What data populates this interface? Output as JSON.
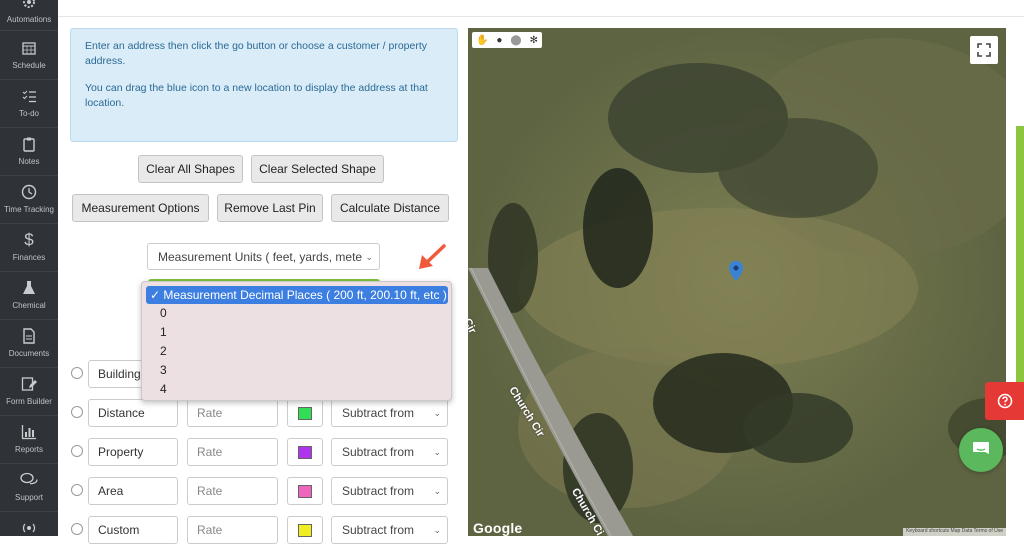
{
  "sidebar": {
    "items": [
      {
        "label": "Automations",
        "icon": "gear-icon"
      },
      {
        "label": "Schedule",
        "icon": "calendar-icon"
      },
      {
        "label": "To-do",
        "icon": "checklist-icon"
      },
      {
        "label": "Notes",
        "icon": "clipboard-icon"
      },
      {
        "label": "Time Tracking",
        "icon": "clock-icon"
      },
      {
        "label": "Finances",
        "icon": "dollar-icon"
      },
      {
        "label": "Chemical",
        "icon": "flask-icon"
      },
      {
        "label": "Documents",
        "icon": "document-icon"
      },
      {
        "label": "Form Builder",
        "icon": "form-edit-icon"
      },
      {
        "label": "Reports",
        "icon": "bar-chart-icon"
      },
      {
        "label": "Support",
        "icon": "chat-bubbles-icon"
      },
      {
        "label": "",
        "icon": "broadcast-icon"
      }
    ]
  },
  "info": {
    "line1": "Enter an address then click the go button or choose a customer / property address.",
    "line2": "You can drag the blue icon to a new location to display the address at that location."
  },
  "buttons": {
    "clear_all": "Clear All Shapes",
    "clear_selected": "Clear Selected Shape",
    "measurement_options": "Measurement Options",
    "remove_last_pin": "Remove Last Pin",
    "calculate_distance": "Calculate Distance"
  },
  "units_select": {
    "value": "Measurement Units ( feet, yards, mete"
  },
  "decimal_dropdown": {
    "options": [
      "✓ Measurement Decimal Places ( 200 ft, 200.10 ft, etc )",
      "0",
      "1",
      "2",
      "3",
      "4"
    ],
    "selected_index": 0
  },
  "shape_rows": [
    {
      "name": "Building",
      "rate": "",
      "color": "",
      "operation": ""
    },
    {
      "name": "Distance",
      "rate": "Rate",
      "color": "#33dd55",
      "operation": "Subtract from"
    },
    {
      "name": "Property",
      "rate": "Rate",
      "color": "#b033ee",
      "operation": "Subtract from"
    },
    {
      "name": "Area",
      "rate": "Rate",
      "color": "#ee66bb",
      "operation": "Subtract from"
    },
    {
      "name": "Custom",
      "rate": "Rate",
      "color": "#eeee22",
      "operation": "Subtract from"
    }
  ],
  "map": {
    "road_label_1": "Church Cir",
    "road_label_2": "Church Ci",
    "road_label_3": "Cir",
    "google": "Google",
    "attribution": "Keyboard shortcuts   Map Data   Terms of Use",
    "tools": [
      "hand-icon",
      "pin-icon",
      "circle-icon",
      "shape-icon"
    ]
  },
  "widgets": {
    "help_icon": "question-icon",
    "chat_icon": "chat-icon"
  },
  "colors": {
    "sidebar": "#2f3236",
    "info_bg": "#d9ecf7",
    "info_text": "#2b6a95",
    "selected_option": "#3d7fe0",
    "help": "#e53935",
    "chat": "#5cb85c"
  }
}
